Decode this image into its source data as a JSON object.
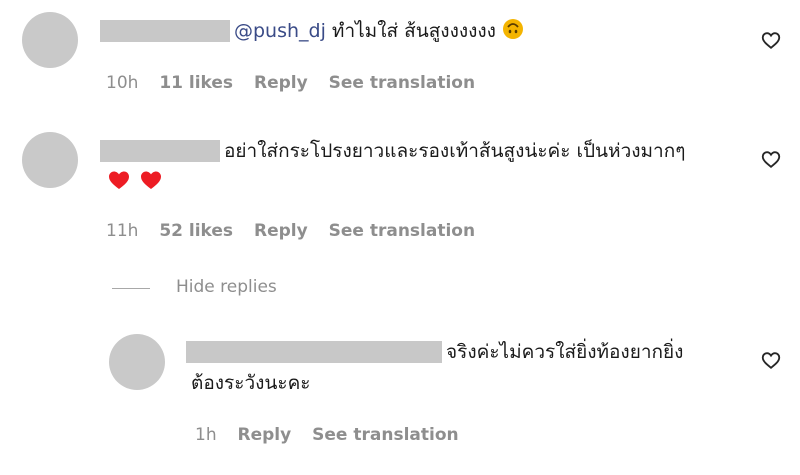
{
  "comments": [
    {
      "mention": "@push_dj",
      "text": " ทำไมใส่ ส้นสูงงงงงง",
      "emoji": "upside-down-face-emoji",
      "time": "10h",
      "likes": "11 likes",
      "reply": "Reply",
      "translate": "See translation"
    },
    {
      "text": "อย่าใส่กระโปรงยาวและรองเท้าส้นสูงน่ะค่ะ เป็นห่วงมากๆ",
      "emoji": "red-heart-emoji",
      "time": "11h",
      "likes": "52 likes",
      "reply": "Reply",
      "translate": "See translation"
    }
  ],
  "thread": {
    "hide_label": "Hide replies"
  },
  "reply": {
    "line1": "จริงค่ะไม่ควรใส่ยิ่งท้องยากยิ่ง",
    "line2": "ต้องระวังนะคะ",
    "time": "1h",
    "reply": "Reply",
    "translate": "See translation"
  },
  "icons": {
    "like": "heart-outline-icon"
  },
  "colors": {
    "meta_text": "#8e8e8e",
    "mention": "#3a4b87",
    "heart_fill": "#ed1c24",
    "placeholder": "#c8c8c8"
  }
}
